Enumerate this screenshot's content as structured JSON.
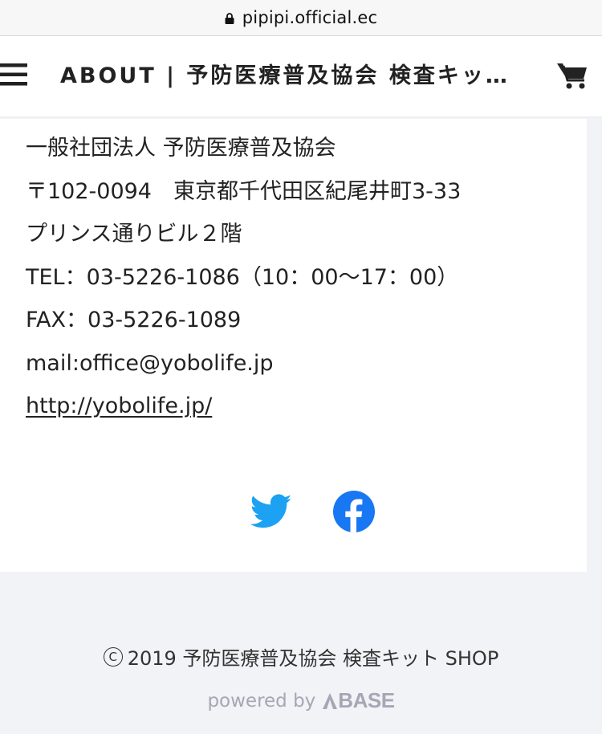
{
  "browser": {
    "url": "pipipi.official.ec",
    "lock_icon": "lock-icon"
  },
  "header": {
    "title": "ABOUT | 予防医療普及協会 検査キッ…",
    "menu_icon": "hamburger-menu-icon",
    "cart_icon": "shopping-cart-icon"
  },
  "about": {
    "lines": [
      "一般社団法人 予防医療普及協会",
      "〒102-0094　東京都千代田区紀尾井町3-33",
      "プリンス通りビル２階",
      "TEL：03-5226-1086（10：00〜17：00）",
      "FAX：03-5226-1089",
      "mail:office@yobolife.jp"
    ],
    "link": "http://yobolife.jp/"
  },
  "social": {
    "twitter_icon": "twitter-icon",
    "facebook_icon": "facebook-icon",
    "twitter_color": "#1da1f2",
    "facebook_color": "#1877f2"
  },
  "footer": {
    "copyright_symbol": "C",
    "copyright": "2019 予防医療普及協会 検査キット SHOP",
    "powered_by": "powered by",
    "base_logo": "BASE"
  }
}
